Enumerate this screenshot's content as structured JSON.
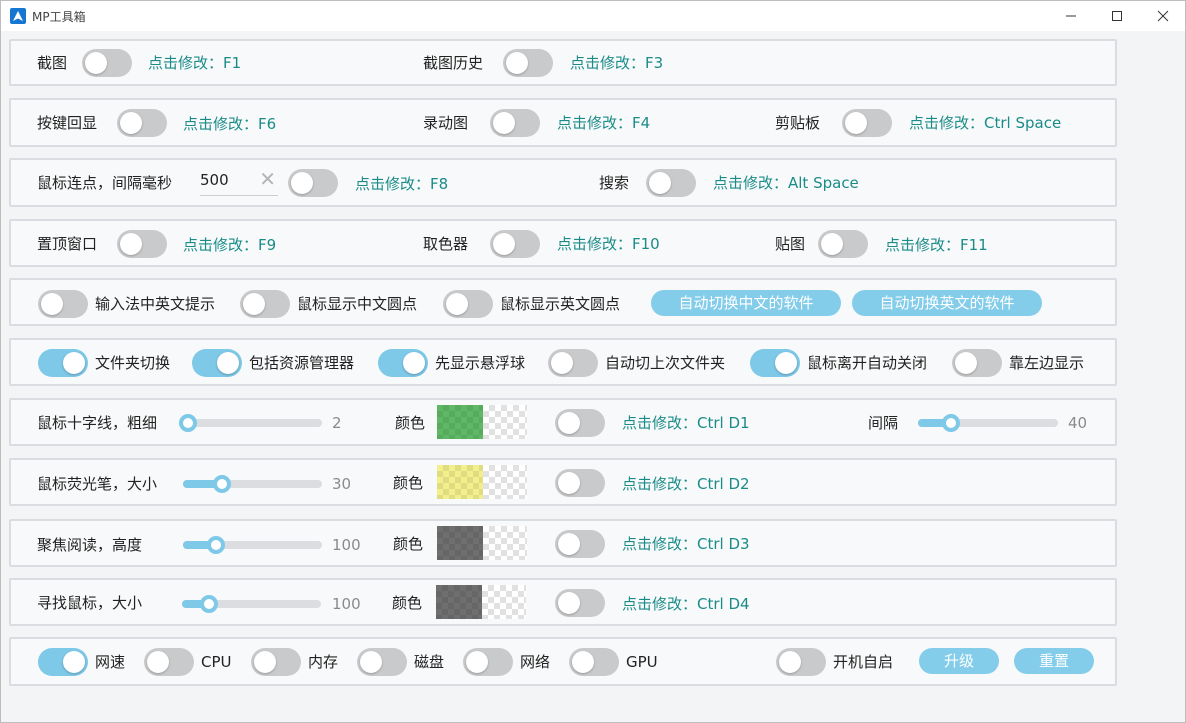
{
  "window": {
    "title": "MP工具箱"
  },
  "row1": {
    "screenshot_label": "截图",
    "screenshot_hotkey": "点击修改：F1",
    "history_label": "截图历史",
    "history_hotkey": "点击修改：F3"
  },
  "row2": {
    "keyecho_label": "按键回显",
    "keyecho_hotkey": "点击修改：F6",
    "gif_label": "录动图",
    "gif_hotkey": "点击修改：F4",
    "clipboard_label": "剪贴板",
    "clipboard_hotkey": "点击修改：Ctrl Space"
  },
  "row3": {
    "autoclick_label": "鼠标连点，间隔毫秒",
    "autoclick_interval": "500",
    "autoclick_hotkey": "点击修改：F8",
    "search_label": "搜索",
    "search_hotkey": "点击修改：Alt Space"
  },
  "row4": {
    "pin_label": "置顶窗口",
    "pin_hotkey": "点击修改：F9",
    "picker_label": "取色器",
    "picker_hotkey": "点击修改：F10",
    "paste_label": "贴图",
    "paste_hotkey": "点击修改：F11"
  },
  "row5": {
    "ime_label": "输入法中英文提示",
    "cn_dot_label": "鼠标显示中文圆点",
    "en_dot_label": "鼠标显示英文圆点",
    "auto_cn_button": "自动切换中文的软件",
    "auto_en_button": "自动切换英文的软件"
  },
  "row6": {
    "folder_switch_label": "文件夹切换",
    "explorer_label": "包括资源管理器",
    "float_ball_label": "先显示悬浮球",
    "last_folder_label": "自动切上次文件夹",
    "auto_close_label": "鼠标离开自动关闭",
    "left_edge_label": "靠左边显示"
  },
  "row7": {
    "crosshair_label": "鼠标十字线，粗细",
    "crosshair_value": "2",
    "crosshair_fraction": 0.0,
    "color_label": "颜色",
    "hotkey": "点击修改：Ctrl D1",
    "gap_label": "间隔",
    "gap_value": "40",
    "gap_fraction": 0.2,
    "color": "#5fb865"
  },
  "row8": {
    "highlighter_label": "鼠标荧光笔，大小",
    "highlighter_value": "30",
    "highlighter_fraction": 0.25,
    "color_label": "颜色",
    "hotkey": "点击修改：Ctrl D2",
    "color": "#f2ef8c"
  },
  "row9": {
    "focus_label": "聚焦阅读，高度",
    "focus_value": "100",
    "focus_fraction": 0.2,
    "color_label": "颜色",
    "hotkey": "点击修改：Ctrl D3",
    "color": "#6f6f6f"
  },
  "row10": {
    "find_label": "寻找鼠标，大小",
    "find_value": "100",
    "find_fraction": 0.15,
    "color_label": "颜色",
    "hotkey": "点击修改：Ctrl D4",
    "color": "#6f6f6f"
  },
  "row11": {
    "net_speed_label": "网速",
    "cpu_label": "CPU",
    "memory_label": "内存",
    "disk_label": "磁盘",
    "network_label": "网络",
    "gpu_label": "GPU",
    "autostart_label": "开机自启",
    "upgrade_button": "升级",
    "reset_button": "重置"
  },
  "toggles": {
    "screenshot": false,
    "history": false,
    "keyecho": false,
    "gif": false,
    "clipboard": false,
    "autoclick": false,
    "search": false,
    "pin": false,
    "picker": false,
    "paste": false,
    "ime": false,
    "cn_dot": false,
    "en_dot": false,
    "folder_switch": true,
    "explorer": true,
    "float_ball": true,
    "last_folder": false,
    "auto_close": true,
    "left_edge": false,
    "crosshair": false,
    "highlighter": false,
    "focus": false,
    "find": false,
    "net_speed": true,
    "cpu": false,
    "memory": false,
    "disk": false,
    "network": false,
    "gpu": false,
    "autostart": false
  },
  "colors": {
    "accent": "#7ec8e8",
    "hotkey_text": "#1a8c88",
    "toggle_off": "#c9cacc"
  }
}
